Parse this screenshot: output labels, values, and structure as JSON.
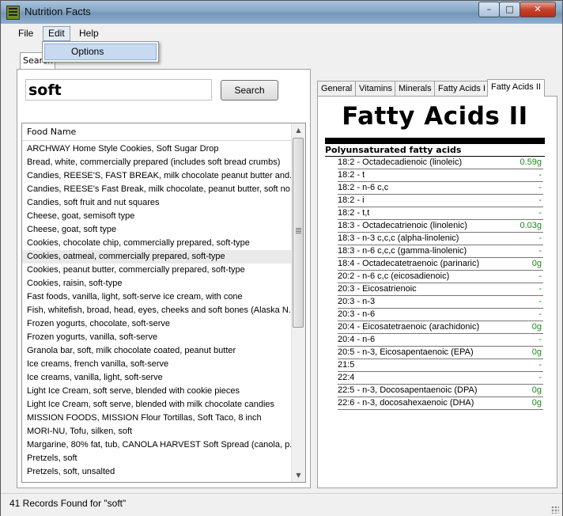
{
  "window": {
    "title": "Nutrition Facts",
    "min_symbol": "–",
    "max_symbol": "□",
    "close_symbol": "✕"
  },
  "menu": {
    "file": "File",
    "edit": "Edit",
    "help": "Help",
    "dropdown_options": "Options"
  },
  "search": {
    "tab_label": "Search",
    "query": "soft",
    "button_label": "Search",
    "column_header": "Food Name",
    "results": [
      "ARCHWAY Home Style Cookies, Soft Sugar Drop",
      "Bread, white, commercially prepared (includes soft bread crumbs)",
      "Candies, REESE'S, FAST BREAK, milk chocolate peanut butter and...",
      "Candies, REESE's Fast Break, milk chocolate, peanut butter, soft no...",
      "Candies, soft fruit and nut squares",
      "Cheese, goat, semisoft type",
      "Cheese, goat, soft type",
      "Cookies, chocolate chip, commercially prepared, soft-type",
      "Cookies, oatmeal, commercially prepared, soft-type",
      "Cookies, peanut butter, commercially prepared, soft-type",
      "Cookies, raisin, soft-type",
      "Fast foods, vanilla, light, soft-serve ice cream, with cone",
      "Fish, whitefish, broad, head, eyes, cheeks and soft bones (Alaska N...",
      "Frozen yogurts, chocolate, soft-serve",
      "Frozen yogurts, vanilla, soft-serve",
      "Granola bar, soft, milk chocolate coated, peanut butter",
      "Ice creams, french vanilla, soft-serve",
      "Ice creams, vanilla, light, soft-serve",
      "Light Ice Cream, soft serve, blended with cookie pieces",
      "Light Ice Cream, soft serve, blended with milk chocolate candies",
      "MISSION FOODS, MISSION Flour Tortillas, Soft Taco, 8 inch",
      "MORI-NU, Tofu, silken, soft",
      "Margarine, 80% fat, tub, CANOLA HARVEST Soft Spread (canola, p...",
      "Pretzels, soft",
      "Pretzels, soft, unsalted"
    ],
    "selected_index": 8,
    "scroll_up": "▲",
    "scroll_down": "▼"
  },
  "detail": {
    "tabs": [
      "General",
      "Vitamins",
      "Minerals",
      "Fatty Acids I",
      "Fatty Acids II"
    ],
    "active_tab": "Fatty Acids II",
    "title": "Fatty Acids II",
    "section": "Polyunsaturated fatty acids",
    "rows": [
      {
        "name": "18:2 - Octadecadienoic (linoleic)",
        "value": "0.59g"
      },
      {
        "name": "18:2 - t",
        "value": "-"
      },
      {
        "name": "18:2 - n-6 c,c",
        "value": "-"
      },
      {
        "name": "18:2 - i",
        "value": "-"
      },
      {
        "name": "18:2 - t,t",
        "value": "-"
      },
      {
        "name": "18:3 - Octadecatrienoic (linolenic)",
        "value": "0.03g"
      },
      {
        "name": "18:3 - n-3 c,c,c (alpha-linolenic)",
        "value": "-"
      },
      {
        "name": "18:3 - n-6 c,c,c (gamma-linolenic)",
        "value": "-"
      },
      {
        "name": "18:4 - Octadecatetraenoic (parinaric)",
        "value": "0g"
      },
      {
        "name": "20:2 - n-6 c,c (eicosadienoic)",
        "value": "-"
      },
      {
        "name": "20:3 - Eicosatrienoic",
        "value": "-"
      },
      {
        "name": "20:3 - n-3",
        "value": "-"
      },
      {
        "name": "20:3 - n-6",
        "value": "-"
      },
      {
        "name": "20:4 - Eicosatetraenoic (arachidonic)",
        "value": "0g"
      },
      {
        "name": "20:4 - n-6",
        "value": "-"
      },
      {
        "name": "20:5 - n-3, Eicosapentaenoic (EPA)",
        "value": "0g"
      },
      {
        "name": "21:5",
        "value": "-"
      },
      {
        "name": "22:4",
        "value": "-"
      },
      {
        "name": "22:5 - n-3, Docosapentaenoic (DPA)",
        "value": "0g"
      },
      {
        "name": "22:6 - n-3, docosahexaenoic (DHA)",
        "value": "0g"
      }
    ],
    "value_color": "#1a8a1a"
  },
  "status": {
    "text": "41 Records Found  for \"soft\""
  }
}
